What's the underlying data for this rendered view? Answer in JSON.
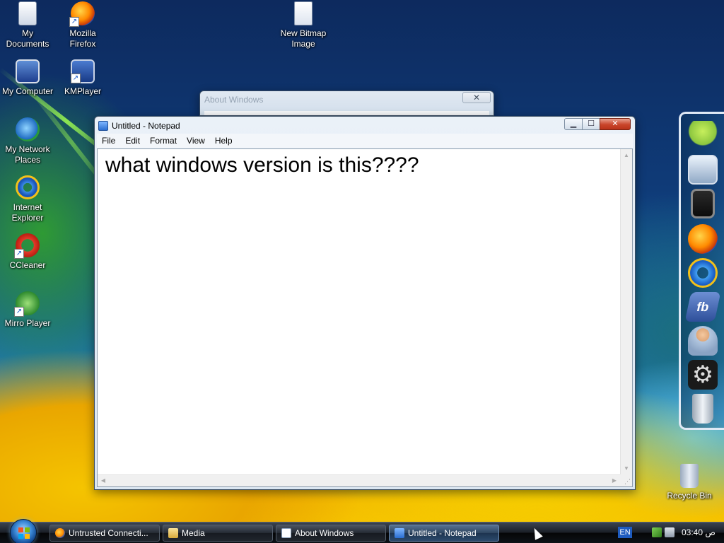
{
  "desktop": {
    "icons": [
      {
        "label": "My\nDocuments",
        "glyph": "documents-icon"
      },
      {
        "label": "Mozilla\nFirefox",
        "glyph": "firefox-icon"
      },
      {
        "label": "New Bitmap\nImage",
        "glyph": "bitmap-file-icon"
      },
      {
        "label": "My Computer",
        "glyph": "computer-icon"
      },
      {
        "label": "KMPlayer",
        "glyph": "kmplayer-icon"
      },
      {
        "label": "My Network\nPlaces",
        "glyph": "network-icon"
      },
      {
        "label": "Internet\nExplorer",
        "glyph": "internet-explorer-icon"
      },
      {
        "label": "CCleaner",
        "glyph": "ccleaner-icon"
      },
      {
        "label": "Mirro Player",
        "glyph": "mirro-player-icon"
      },
      {
        "label": "Recycle Bin",
        "glyph": "recycle-bin-icon"
      }
    ]
  },
  "about_window": {
    "title": "About Windows",
    "close_glyph": "✕"
  },
  "notepad": {
    "title": "Untitled - Notepad",
    "menu": [
      "File",
      "Edit",
      "Format",
      "View",
      "Help"
    ],
    "content": "what windows version is this????",
    "buttons": {
      "minimize": "▁",
      "maximize": "☐",
      "close": "✕"
    }
  },
  "dock": {
    "items": [
      "android-icon",
      "remote-desktop-icon",
      "tablet-icon",
      "firefox-icon",
      "internet-explorer-icon",
      "facebook-icon",
      "support-agent-icon",
      "settings-gear-icon",
      "trash-can-icon"
    ],
    "fb_label": "fb",
    "gear_glyph": "⚙"
  },
  "taskbar": {
    "tasks": [
      {
        "label": "Untrusted Connecti...",
        "icon": "firefox-icon"
      },
      {
        "label": "Media",
        "icon": "folder-icon"
      },
      {
        "label": "About Windows",
        "icon": "window-icon"
      },
      {
        "label": "Untitled - Notepad",
        "icon": "notepad-icon",
        "active": true
      }
    ],
    "language": "EN",
    "clock": "03:40 ص"
  }
}
